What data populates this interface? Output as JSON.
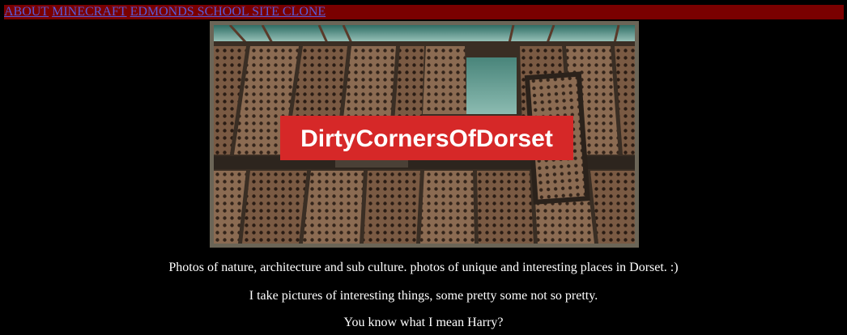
{
  "nav": {
    "links": [
      {
        "label": "ABOUT"
      },
      {
        "label": "MINECRAFT"
      },
      {
        "label": "EDMONDS SCHOOL SITE CLONE"
      }
    ]
  },
  "banner": {
    "logo_text": "DirtyCornersOfDorset",
    "logo_bg": "#d62828",
    "logo_fg": "#ffffff"
  },
  "content": {
    "paragraphs": [
      "Photos of nature, architecture and sub culture. photos of unique and interesting places in Dorset. :)",
      "I take pictures of interesting things, some pretty some not so pretty.",
      "You know what I mean Harry?"
    ]
  },
  "colors": {
    "nav_bg": "#7a0000",
    "link": "#5a5ad8",
    "page_bg": "#000000",
    "text": "#ffffff"
  }
}
